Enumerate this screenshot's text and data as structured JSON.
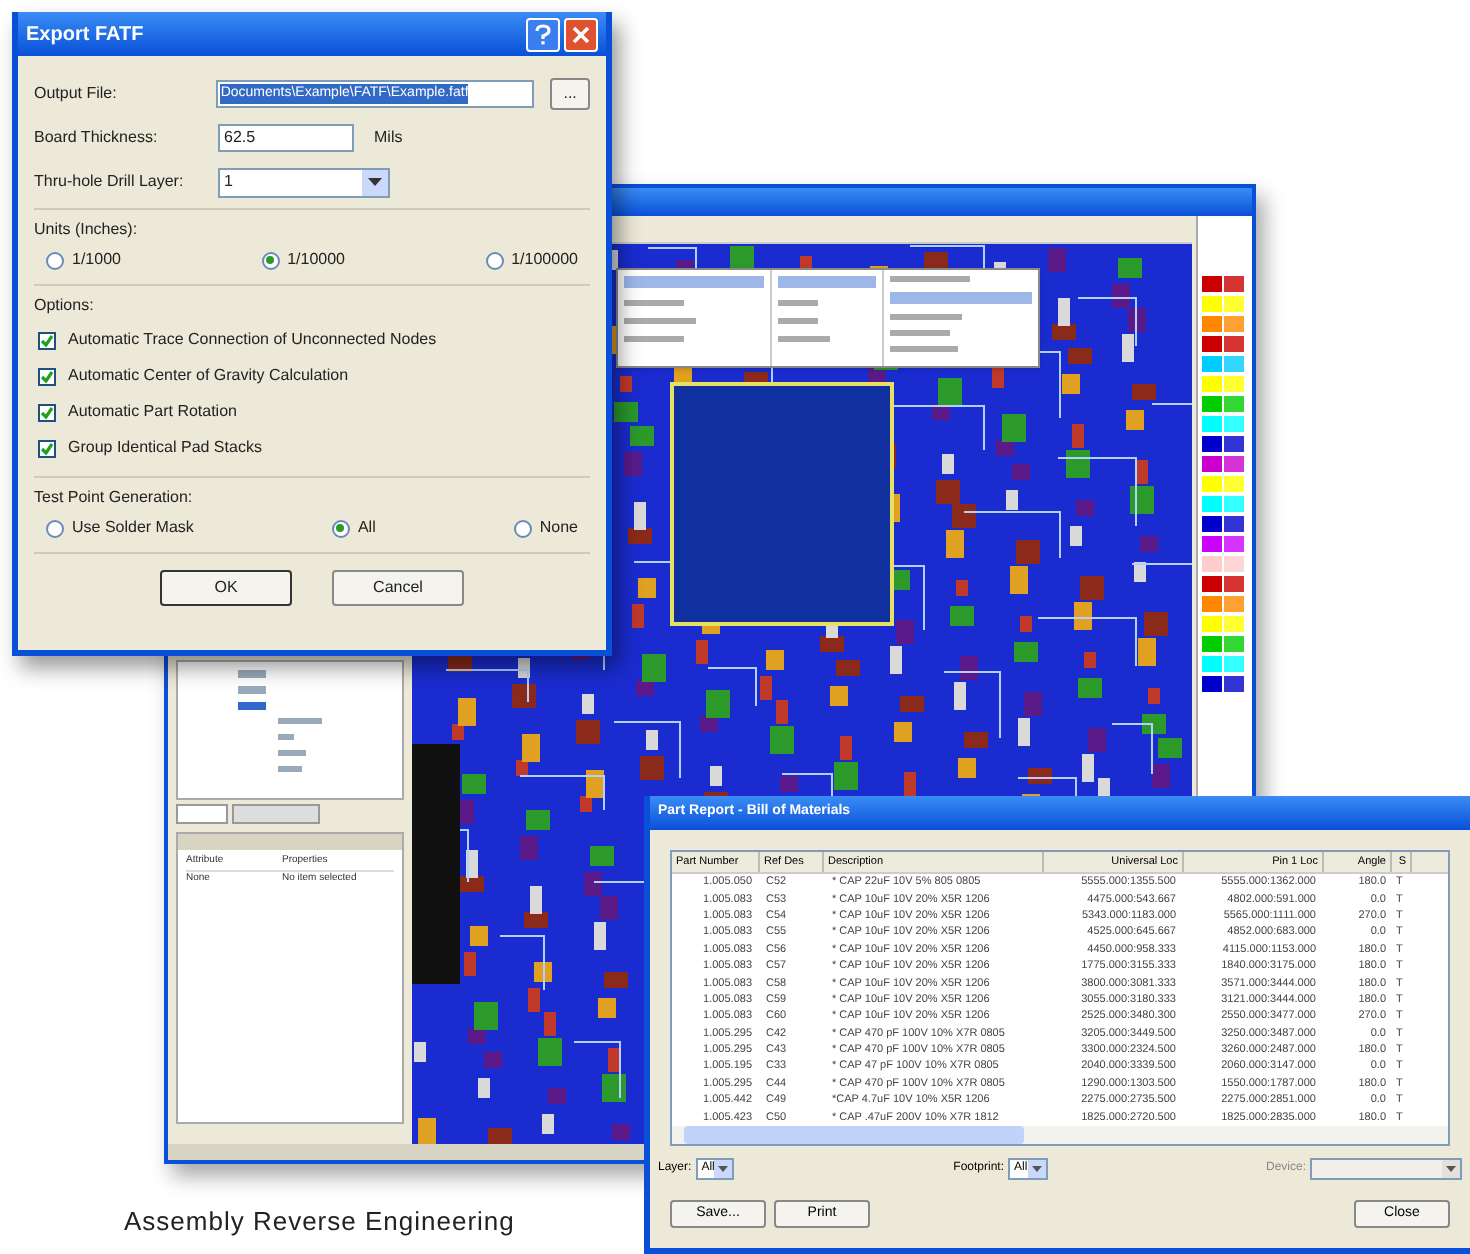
{
  "dialog": {
    "title": "Export FATF",
    "fields": [
      {
        "kind": "path",
        "label": "Output File:",
        "value": "Documents\\Example\\FATF\\Example.fatf",
        "button": "..."
      },
      {
        "kind": "text",
        "label": "Board Thickness:",
        "value": "62.5",
        "unit": "Mils"
      },
      {
        "kind": "select",
        "label": "Thru-hole Drill Layer:",
        "value": "1"
      }
    ],
    "units": {
      "label": "Units (Inches):",
      "options": [
        {
          "label": "1/1000",
          "selected": false
        },
        {
          "label": "1/10000",
          "selected": true
        },
        {
          "label": "1/100000",
          "selected": false
        }
      ]
    },
    "options": {
      "label": "Options:",
      "items": [
        {
          "label": "Automatic Trace Connection of Unconnected Nodes",
          "checked": true
        },
        {
          "label": "Automatic Center of Gravity Calculation",
          "checked": true
        },
        {
          "label": "Automatic Part Rotation",
          "checked": true
        },
        {
          "label": "Group Identical Pad Stacks",
          "checked": true
        }
      ]
    },
    "test_points": {
      "label": "Test Point Generation:",
      "options": [
        {
          "label": "Use Solder Mask",
          "selected": false
        },
        {
          "label": "All",
          "selected": true
        },
        {
          "label": "None",
          "selected": false
        }
      ]
    },
    "buttons": [
      "OK",
      "Cancel"
    ]
  },
  "main_window": {
    "properties": {
      "columns": [
        "Attribute",
        "Properties"
      ],
      "rows": [
        [
          "None",
          "No item selected"
        ]
      ]
    }
  },
  "bom": {
    "title": "Part Report - Bill of Materials",
    "columns": [
      "Part Number",
      "Ref Des",
      "Description",
      "Universal Loc",
      "Pin 1 Loc",
      "Angle",
      "S"
    ],
    "rows": [
      [
        "1.005.050",
        "C52",
        "* CAP 22uF 10V 5% 805 0805",
        "5555.000:1355.500",
        "5555.000:1362.000",
        "180.0",
        "T"
      ],
      [
        "1.005.083",
        "C53",
        "* CAP 10uF 10V 20% X5R 1206",
        "4475.000:543.667",
        "4802.000:591.000",
        "0.0",
        "T"
      ],
      [
        "1.005.083",
        "C54",
        "* CAP 10uF 10V 20% X5R 1206",
        "5343.000:1183.000",
        "5565.000:1111.000",
        "270.0",
        "T"
      ],
      [
        "1.005.083",
        "C55",
        "* CAP 10uF 10V 20% X5R 1206",
        "4525.000:645.667",
        "4852.000:683.000",
        "0.0",
        "T"
      ],
      [
        "1.005.083",
        "C56",
        "* CAP 10uF 10V 20% X5R 1206",
        "4450.000:958.333",
        "4115.000:1153.000",
        "180.0",
        "T"
      ],
      [
        "1.005.083",
        "C57",
        "* CAP 10uF 10V 20% X5R 1206",
        "1775.000:3155.333",
        "1840.000:3175.000",
        "180.0",
        "T"
      ],
      [
        "1.005.083",
        "C58",
        "* CAP 10uF 10V 20% X5R 1206",
        "3800.000:3081.333",
        "3571.000:3444.000",
        "180.0",
        "T"
      ],
      [
        "1.005.083",
        "C59",
        "* CAP 10uF 10V 20% X5R 1206",
        "3055.000:3180.333",
        "3121.000:3444.000",
        "180.0",
        "T"
      ],
      [
        "1.005.083",
        "C60",
        "* CAP 10uF 10V 20% X5R 1206",
        "2525.000:3480.300",
        "2550.000:3477.000",
        "270.0",
        "T"
      ],
      [
        "1.005.295",
        "C42",
        "* CAP 470 pF 100V 10% X7R 0805",
        "3205.000:3449.500",
        "3250.000:3487.000",
        "0.0",
        "T"
      ],
      [
        "1.005.295",
        "C43",
        "* CAP 470 pF 100V 10% X7R 0805",
        "3300.000:2324.500",
        "3260.000:2487.000",
        "180.0",
        "T"
      ],
      [
        "1.005.195",
        "C33",
        "* CAP 47 pF 100V 10% X7R 0805",
        "2040.000:3339.500",
        "2060.000:3147.000",
        "0.0",
        "T"
      ],
      [
        "1.005.295",
        "C44",
        "* CAP 470 pF 100V 10% X7R 0805",
        "1290.000:1303.500",
        "1550.000:1787.000",
        "180.0",
        "T"
      ],
      [
        "1.005.442",
        "C49",
        "*CAP 4.7uF 10V 10% X5R 1206",
        "2275.000:2735.500",
        "2275.000:2851.000",
        "0.0",
        "T"
      ],
      [
        "1.005.423",
        "C50",
        "* CAP .47uF 200V 10% X7R 1812",
        "1825.000:2720.500",
        "1825.000:2835.000",
        "180.0",
        "T"
      ]
    ],
    "filters": [
      {
        "label": "Layer:",
        "value": "All",
        "disabled": false
      },
      {
        "label": "Footprint:",
        "value": "All",
        "disabled": false
      },
      {
        "label": "Device:",
        "disabled": true
      }
    ],
    "buttons": [
      "Save...",
      "Print",
      "Close"
    ]
  },
  "caption": "Assembly Reverse Engineering"
}
